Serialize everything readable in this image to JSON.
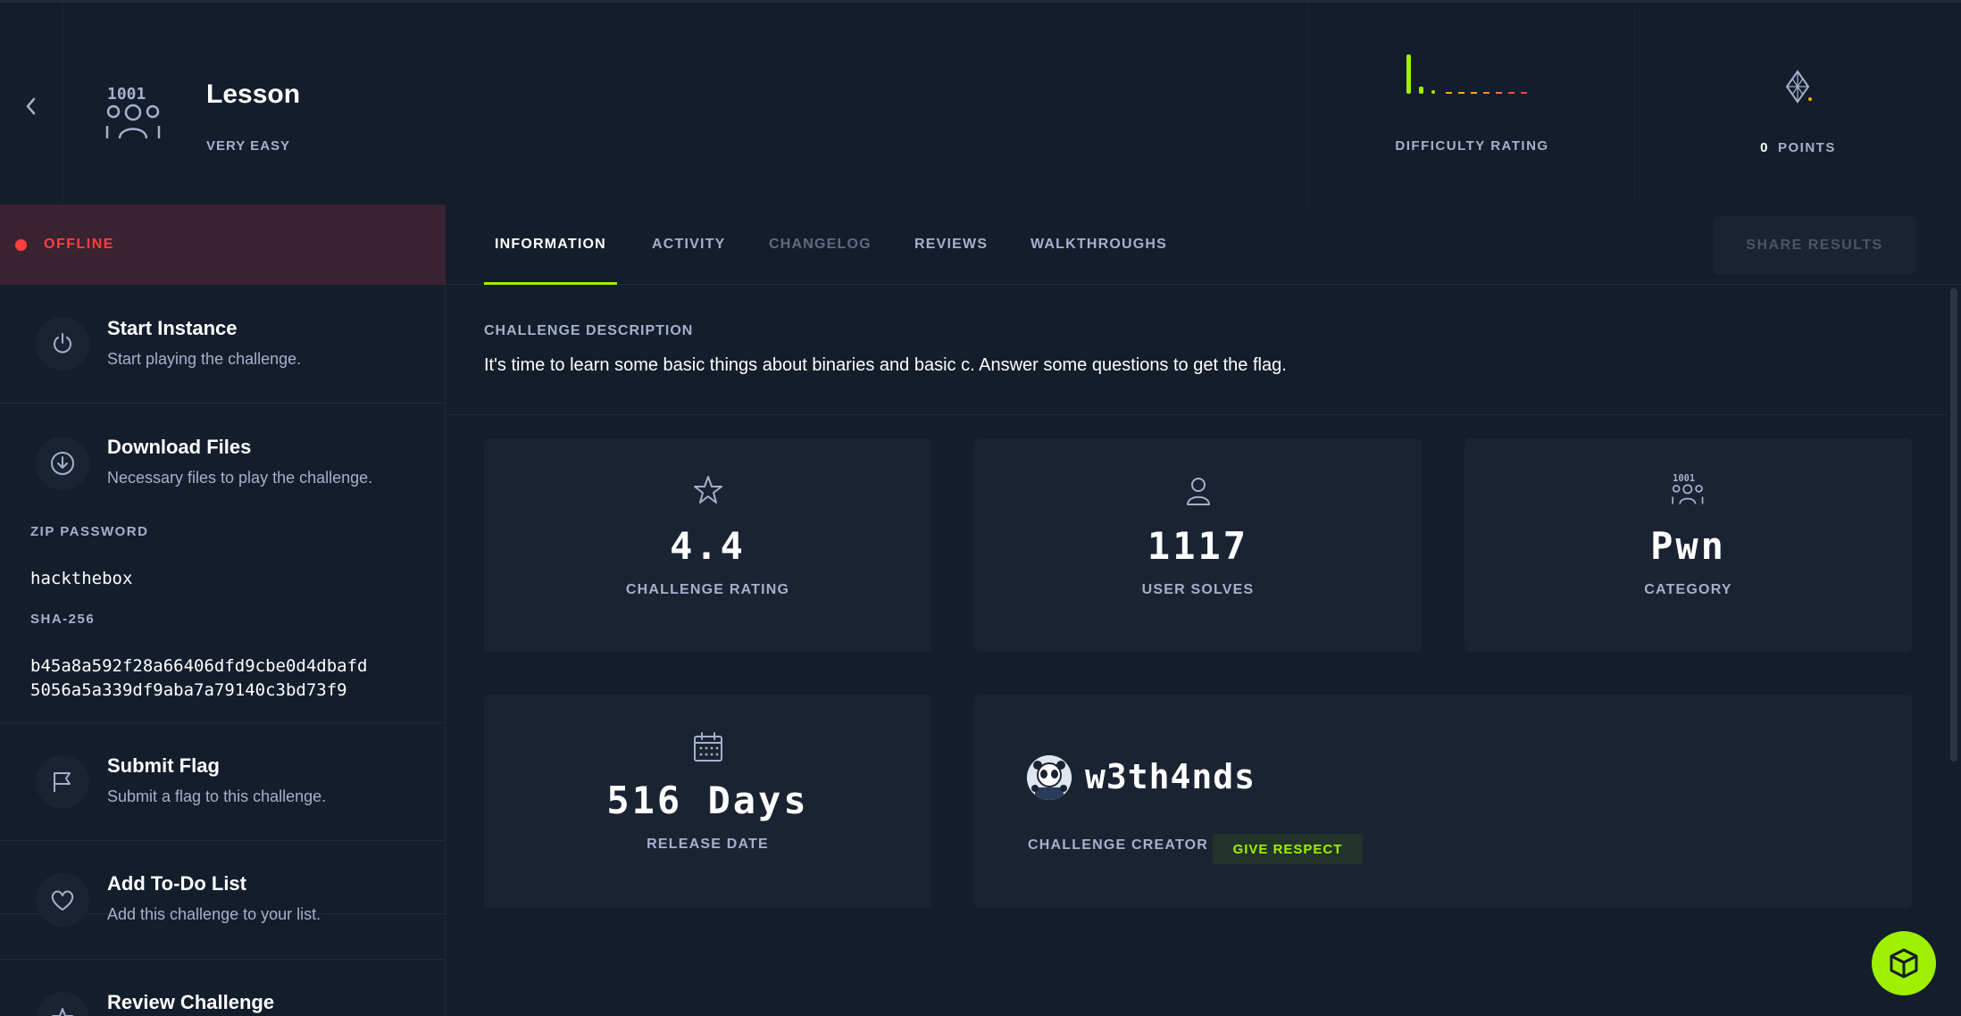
{
  "header": {
    "title": "Lesson",
    "difficulty": "VERY EASY",
    "difficulty_rating_label": "DIFFICULTY RATING",
    "points_value": "0",
    "points_label": "POINTS"
  },
  "status": {
    "text": "OFFLINE",
    "color": "#ff3e3e"
  },
  "sidebar": {
    "actions": [
      {
        "title": "Start Instance",
        "desc": "Start playing the challenge."
      },
      {
        "title": "Download Files",
        "desc": "Necessary files to play the challenge."
      },
      {
        "title": "Submit Flag",
        "desc": "Submit a flag to this challenge."
      },
      {
        "title": "Add To-Do List",
        "desc": "Add this challenge to your list."
      },
      {
        "title": "Review Challenge"
      }
    ],
    "zip_password_label": "ZIP PASSWORD",
    "zip_password": "hackthebox",
    "sha_label": "SHA-256",
    "sha_line1": "b45a8a592f28a66406dfd9cbe0d4dbafd",
    "sha_line2": "5056a5a339df9aba7a79140c3bd73f9"
  },
  "tabs": [
    {
      "label": "INFORMATION",
      "state": "active"
    },
    {
      "label": "ACTIVITY",
      "state": "normal"
    },
    {
      "label": "CHANGELOG",
      "state": "dim"
    },
    {
      "label": "REVIEWS",
      "state": "normal"
    },
    {
      "label": "WALKTHROUGHS",
      "state": "normal"
    }
  ],
  "share_button": "SHARE RESULTS",
  "description": {
    "label": "CHALLENGE DESCRIPTION",
    "text": "It's time to learn some basic things about binaries and basic c. Answer some questions to get the flag."
  },
  "stats": {
    "rating": {
      "value": "4.4",
      "label": "CHALLENGE RATING"
    },
    "solves": {
      "value": "1117",
      "label": "USER SOLVES"
    },
    "category": {
      "value": "Pwn",
      "label": "CATEGORY"
    },
    "release": {
      "value": "516 Days",
      "label": "RELEASE DATE"
    }
  },
  "creator": {
    "name": "w3th4nds",
    "label": "CHALLENGE CREATOR",
    "respect_button": "GIVE RESPECT"
  },
  "colors": {
    "accent": "#9fef00",
    "bg": "#141d2b",
    "card": "#1a2332",
    "text_muted": "#a4b1cd"
  }
}
